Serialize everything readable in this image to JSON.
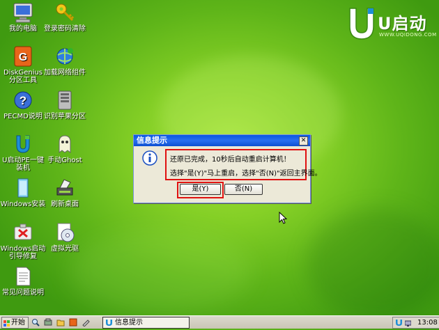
{
  "desktop": {
    "icons": [
      {
        "label": "我的电脑",
        "icon": "my-computer-icon"
      },
      {
        "label": "登录密码清除",
        "icon": "key-icon"
      },
      {
        "label": "DiskGenius分区工具",
        "icon": "diskgenius-icon"
      },
      {
        "label": "加载网络组件",
        "icon": "network-icon"
      },
      {
        "label": "PECMD说明",
        "icon": "help-icon"
      },
      {
        "label": "识别苹果分区",
        "icon": "drive-icon"
      },
      {
        "label": "U启动PE一键装机",
        "icon": "u-start-icon"
      },
      {
        "label": "手动Ghost",
        "icon": "ghost-icon"
      },
      {
        "label": "Windows安装",
        "icon": "windows-setup-icon"
      },
      {
        "label": "刷新桌面",
        "icon": "refresh-desktop-icon"
      },
      {
        "label": "Windows启动引导修复",
        "icon": "boot-repair-icon"
      },
      {
        "label": "虚拟光驱",
        "icon": "virtual-cd-icon"
      },
      {
        "label": "常见问题说明",
        "icon": "document-icon"
      }
    ]
  },
  "logo": {
    "text": "U启动",
    "sub": "WWW.UQIDONG.COM"
  },
  "dialog": {
    "title": "信息提示",
    "line1": "还原已完成，10秒后自动重启计算机！",
    "line2": "选择\"是(Y)\"马上重启，选择\"否(N)\"返回主界面。",
    "yes_label": "是(Y)",
    "no_label": "否(N)",
    "close_glyph": "✕"
  },
  "taskbar": {
    "start_label": "开始",
    "task_label": "信息提示",
    "clock": "13:08"
  },
  "colors": {
    "highlight": "#e01010",
    "titlebar": "#0a58e0",
    "desktop": "#84cf26"
  }
}
